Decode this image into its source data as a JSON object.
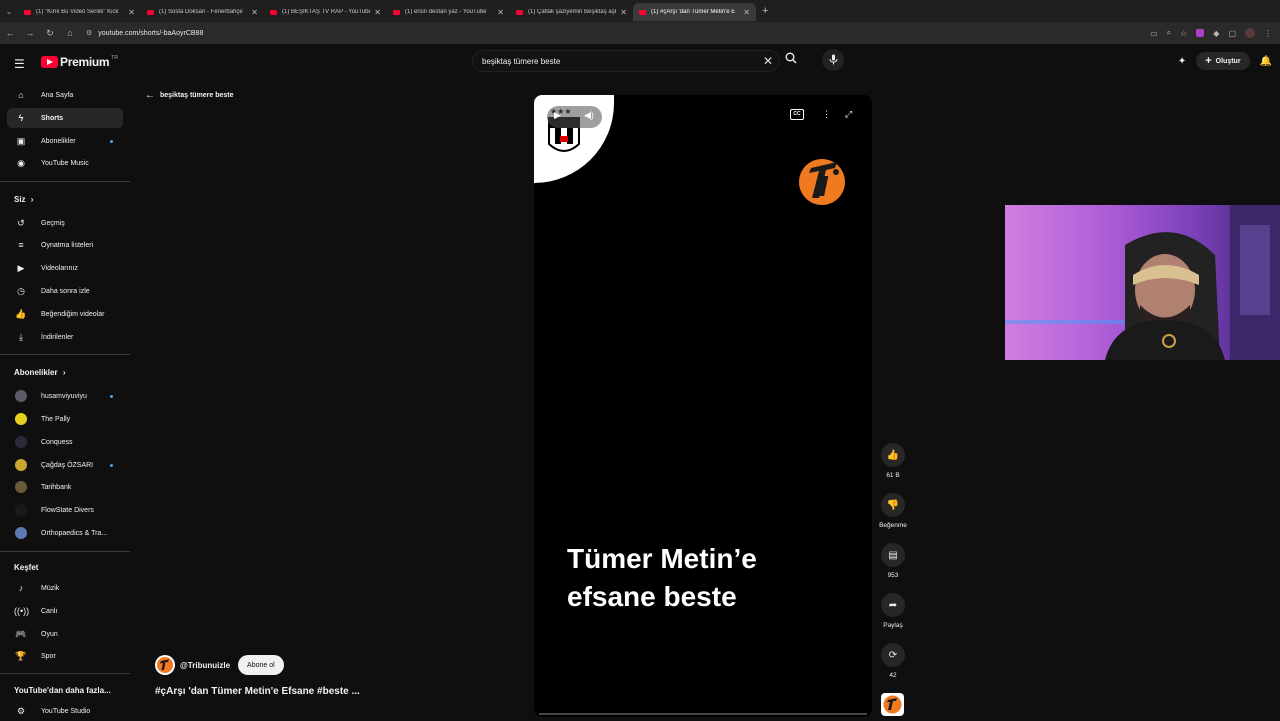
{
  "browser": {
    "tabs": [
      {
        "title": "(1) \"Kırık Bu Video Senlik\" Kick"
      },
      {
        "title": "(1) Sosta Doksan - Fenerbahçe"
      },
      {
        "title": "(1) BEŞİKTAŞ TV RAP - YouTube"
      },
      {
        "title": "(1) ersin destan yaz - YouTube"
      },
      {
        "title": "(1) Çatlak şaziyemin Beşiktaş aşk"
      },
      {
        "title": "(1) #çArşı 'dan Tümer Metin'e E"
      }
    ],
    "url": "youtube.com/shorts/-baAoyrCB88"
  },
  "header": {
    "logo_text": "Premium",
    "country": "TR",
    "search_value": "beşiktaş tümere beste",
    "create_label": "Oluştur"
  },
  "sidebar": {
    "main": [
      {
        "label": "Ana Sayfa",
        "icon": "home-icon"
      },
      {
        "label": "Shorts",
        "icon": "shorts-icon"
      },
      {
        "label": "Abonelikler",
        "icon": "subscriptions-icon"
      },
      {
        "label": "YouTube Music",
        "icon": "music-icon"
      }
    ],
    "you_heading": "Siz",
    "you": [
      {
        "label": "Geçmiş",
        "icon": "history-icon"
      },
      {
        "label": "Oynatma listeleri",
        "icon": "playlists-icon"
      },
      {
        "label": "Videolarınız",
        "icon": "your-videos-icon"
      },
      {
        "label": "Daha sonra izle",
        "icon": "watch-later-icon"
      },
      {
        "label": "Beğendiğim videolar",
        "icon": "liked-icon"
      },
      {
        "label": "İndirilenler",
        "icon": "download-icon"
      }
    ],
    "subs_heading": "Abonelikler",
    "subs": [
      {
        "label": "husamviyuviyu",
        "color": "#5a5a6a"
      },
      {
        "label": "The Pally",
        "color": "#e8d020"
      },
      {
        "label": "Conquess",
        "color": "#2a2a3a"
      },
      {
        "label": "Çağdaş ÖZSARI",
        "color": "#c8a830"
      },
      {
        "label": "Tarihbank",
        "color": "#6a5a3a"
      },
      {
        "label": "FlowState Divers",
        "color": "#1a1a1a"
      },
      {
        "label": "Orthopaedics & Tra...",
        "color": "#5a7ab0"
      }
    ],
    "explore_heading": "Keşfet",
    "explore": [
      {
        "label": "Müzik",
        "icon": "music-note-icon"
      },
      {
        "label": "Canlı",
        "icon": "live-icon"
      },
      {
        "label": "Oyun",
        "icon": "gaming-icon"
      },
      {
        "label": "Spor",
        "icon": "trophy-icon"
      }
    ],
    "more_heading": "YouTube'dan daha fazla...",
    "more": [
      {
        "label": "YouTube Studio",
        "icon": "studio-icon"
      }
    ]
  },
  "main": {
    "back_label": "beşiktaş tümere beste",
    "caption_line1": "Tümer Metin’e",
    "caption_line2": "efsane beste",
    "channel_name": "@Tribunuizle",
    "subscribe_label": "Abone ol",
    "video_title": "#çArşı 'dan Tümer Metin'e Efsane #beste ..."
  },
  "actions": {
    "like": "61 B",
    "dislike": "Beğenme",
    "comments": "953",
    "share": "Paylaş",
    "remix": "42"
  },
  "colors": {
    "accent": "#ff0033",
    "ti_orange": "#f07a20",
    "bg": "#0f0f0f"
  }
}
